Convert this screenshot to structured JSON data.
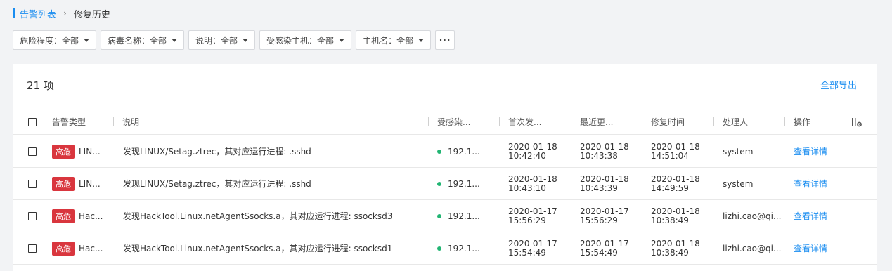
{
  "breadcrumb": {
    "parent": "告警列表",
    "separator": "›",
    "current": "修复历史"
  },
  "filters": [
    {
      "label": "危险程度：全部"
    },
    {
      "label": "病毒名称：全部"
    },
    {
      "label": "说明：全部"
    },
    {
      "label": "受感染主机：全部"
    },
    {
      "label": "主机名：全部"
    }
  ],
  "more_label": "···",
  "count_label": "21 项",
  "export_label": "全部导出",
  "columns": {
    "alert_type": "告警类型",
    "desc": "说明",
    "host": "受感染...",
    "first": "首次发...",
    "last": "最近更...",
    "repair": "修复时间",
    "handler": "处理人",
    "action": "操作"
  },
  "rows": [
    {
      "level": "高危",
      "type": "LIN...",
      "desc": "发现LINUX/Setag.ztrec，其对应运行进程: .sshd",
      "host": "192.1...",
      "first_date": "2020-01-18",
      "first_time": "10:42:40",
      "last_date": "2020-01-18",
      "last_time": "10:43:38",
      "repair_date": "2020-01-18",
      "repair_time": "14:51:04",
      "handler": "system",
      "action": "查看详情"
    },
    {
      "level": "高危",
      "type": "LIN...",
      "desc": "发现LINUX/Setag.ztrec，其对应运行进程: .sshd",
      "host": "192.1...",
      "first_date": "2020-01-18",
      "first_time": "10:43:10",
      "last_date": "2020-01-18",
      "last_time": "10:43:39",
      "repair_date": "2020-01-18",
      "repair_time": "14:49:59",
      "handler": "system",
      "action": "查看详情"
    },
    {
      "level": "高危",
      "type": "Hac...",
      "desc": "发现HackTool.Linux.netAgentSsocks.a，其对应运行进程: ssocksd3",
      "host": "192.1...",
      "first_date": "2020-01-17",
      "first_time": "15:56:29",
      "last_date": "2020-01-17",
      "last_time": "15:56:29",
      "repair_date": "2020-01-18",
      "repair_time": "10:38:49",
      "handler": "lizhi.cao@qi...",
      "action": "查看详情"
    },
    {
      "level": "高危",
      "type": "Hac...",
      "desc": "发现HackTool.Linux.netAgentSsocks.a，其对应运行进程: ssocksd1",
      "host": "192.1...",
      "first_date": "2020-01-17",
      "first_time": "15:54:49",
      "last_date": "2020-01-17",
      "last_time": "15:54:49",
      "repair_date": "2020-01-18",
      "repair_time": "10:38:49",
      "handler": "lizhi.cao@qi...",
      "action": "查看详情"
    }
  ],
  "colors": {
    "accent": "#1a8df0",
    "danger": "#d9363e",
    "online": "#22b573"
  }
}
